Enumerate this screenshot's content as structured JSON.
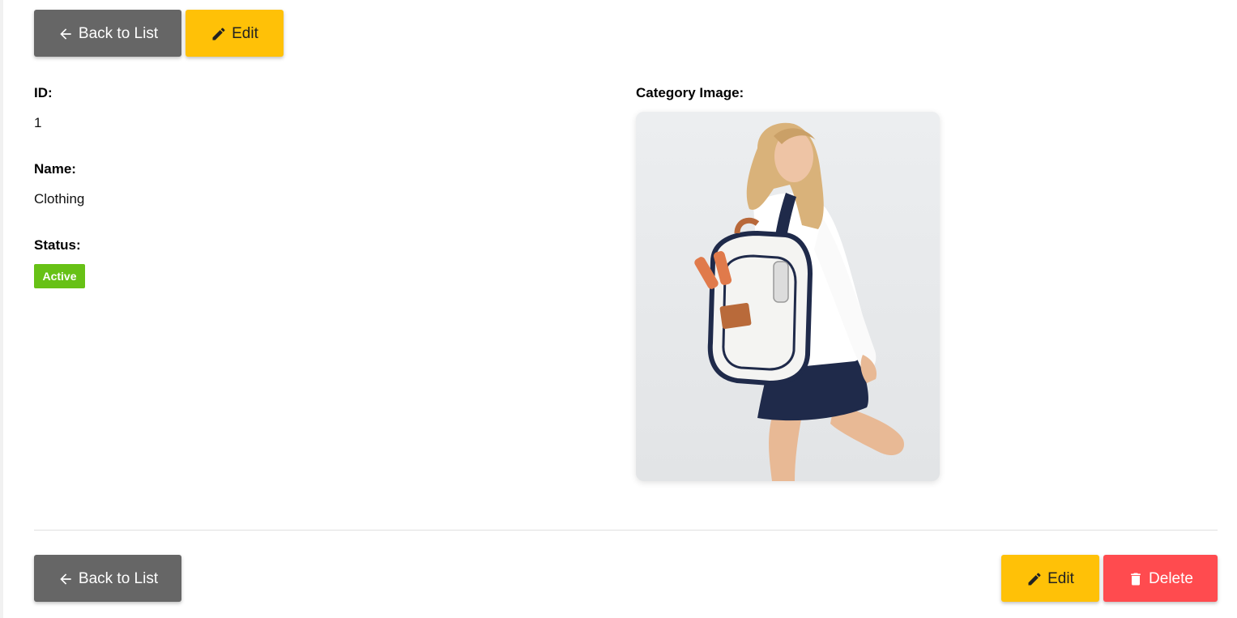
{
  "toolbar_top": {
    "back_label": "Back to List",
    "edit_label": "Edit"
  },
  "fields": {
    "id_label": "ID:",
    "id_value": "1",
    "name_label": "Name:",
    "name_value": "Clothing",
    "status_label": "Status:",
    "status_value": "Active",
    "image_label": "Category Image:"
  },
  "toolbar_bottom": {
    "back_label": "Back to List",
    "edit_label": "Edit",
    "delete_label": "Delete"
  },
  "colors": {
    "back_button": "#666666",
    "edit_button": "#ffc107",
    "delete_button": "#ff4b4f",
    "status_active": "#67c116"
  },
  "icons": {
    "back": "arrow-left-icon",
    "edit": "pencil-icon",
    "delete": "trash-icon"
  }
}
